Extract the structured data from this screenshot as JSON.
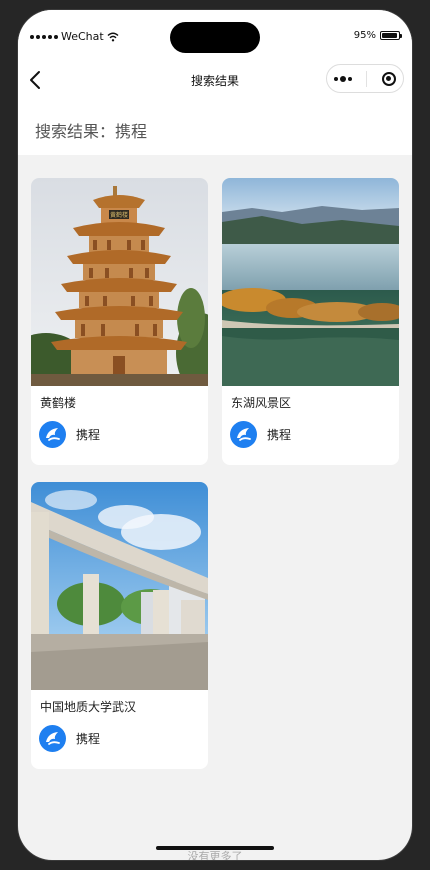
{
  "status_bar": {
    "carrier": "WeChat",
    "battery": "95%",
    "battery_level": 0.95
  },
  "nav": {
    "title": "搜索结果"
  },
  "search": {
    "heading": "搜索结果：携程"
  },
  "results": [
    {
      "name": "黄鹤楼",
      "brand": "携程",
      "sign": "黄鹤楼"
    },
    {
      "name": "东湖风景区",
      "brand": "携程"
    },
    {
      "name": "中国地质大学武汉",
      "brand": "携程"
    }
  ],
  "footer": {
    "text": "没有更多了"
  },
  "colors": {
    "brand_blue": "#1e7ff0",
    "page_bg": "#f2f2f2"
  }
}
